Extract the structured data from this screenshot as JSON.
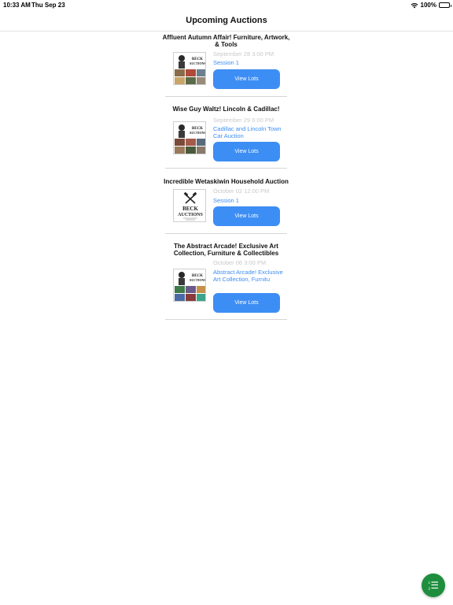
{
  "status_bar": {
    "time": "10:33 AM",
    "date": "Thu Sep 23",
    "battery": "100%"
  },
  "nav": {
    "title": "Upcoming Auctions"
  },
  "auctions": [
    {
      "title": "Affluent Autumn Affair! Furniture, Artwork, & Tools",
      "date": "September 28 3:00 PM",
      "session": "Session 1",
      "button_label": "View Lots",
      "thumbnail": "beck-auctions-collage"
    },
    {
      "title": "Wise Guy Waltz! Lincoln & Cadillac!",
      "date": "September 29 6:00 PM",
      "session": "Cadillac and Lincoln Town Car Auction",
      "button_label": "View Lots",
      "thumbnail": "beck-auctions-collage"
    },
    {
      "title": "Incredible Wetaskiwin Household Auction",
      "date": "October 02 12:00 PM",
      "session": "Session 1",
      "button_label": "View Lots",
      "thumbnail": "beck-auctions-logo"
    },
    {
      "title": "The Abstract Arcade! Exclusive Art Collection, Furniture & Collectibles",
      "date": "October 06 3:00 PM",
      "session": "Abstract Arcade! Exclusive Art Collection, Furnitu",
      "button_label": "View Lots",
      "thumbnail": "beck-auctions-collage"
    }
  ],
  "fab": {
    "icon": "list-icon",
    "color": "#1e8e3e"
  },
  "colors": {
    "accent": "#3d8ef4",
    "date_text": "#c9c9c9",
    "divider": "#d6d6d6"
  }
}
